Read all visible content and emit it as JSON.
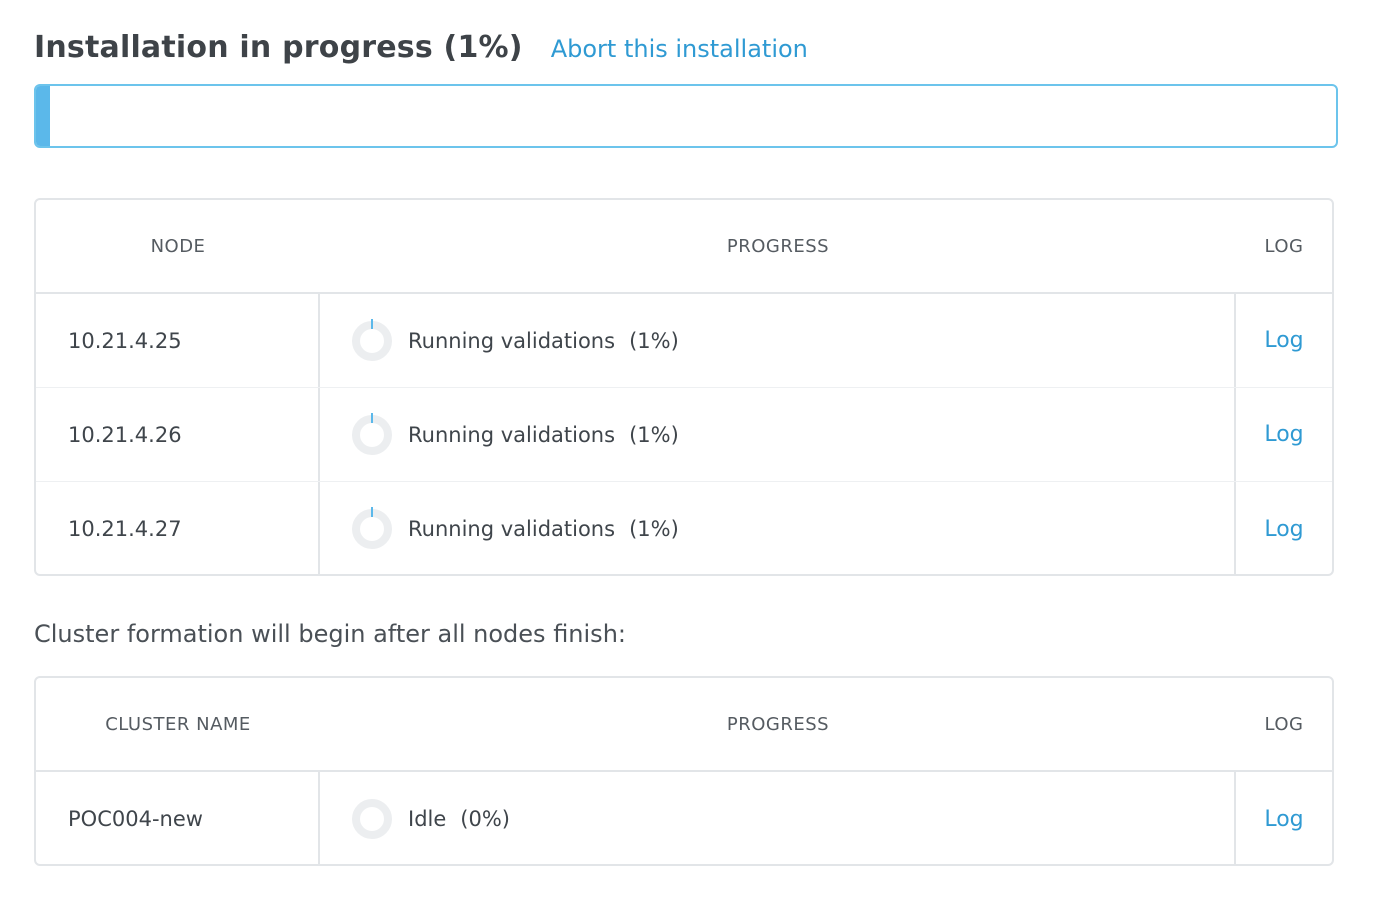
{
  "header": {
    "title": "Installation in progress (1%)",
    "abort_link": "Abort this installation"
  },
  "overall_progress": {
    "percent": 1,
    "color": "#5bb8ea"
  },
  "nodes_table": {
    "columns": [
      "NODE",
      "PROGRESS",
      "LOG"
    ],
    "rows": [
      {
        "node": "10.21.4.25",
        "status": "Running validations",
        "percent": "(1%)",
        "log": "Log"
      },
      {
        "node": "10.21.4.26",
        "status": "Running validations",
        "percent": "(1%)",
        "log": "Log"
      },
      {
        "node": "10.21.4.27",
        "status": "Running validations",
        "percent": "(1%)",
        "log": "Log"
      }
    ]
  },
  "cluster_note": "Cluster formation will begin after all nodes finish:",
  "cluster_table": {
    "columns": [
      "CLUSTER NAME",
      "PROGRESS",
      "LOG"
    ],
    "rows": [
      {
        "name": "POC004-new",
        "status": "Idle",
        "percent": "(0%)",
        "log": "Log"
      }
    ]
  },
  "colors": {
    "accent": "#2f9ad3",
    "progress_border": "#6cc4ec",
    "table_border": "#e2e5e8"
  },
  "icons": {
    "row_progress": "progress-spinner-icon"
  }
}
